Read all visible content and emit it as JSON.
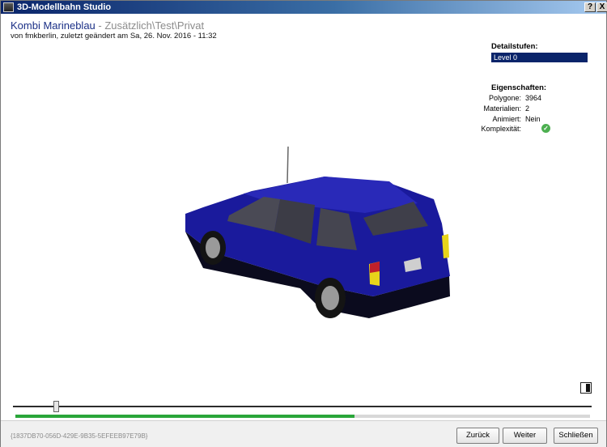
{
  "window": {
    "title": "3D-Modellbahn Studio",
    "help_label": "?",
    "close_label": "X"
  },
  "header": {
    "model_name": "Kombi Marineblau",
    "path": " - Zusätzlich\\Test\\Privat",
    "subtitle": "von fmkberlin, zuletzt geändert am Sa, 26. Nov. 2016 - 11:32"
  },
  "details": {
    "label": "Detailstufen:",
    "selected_level": "Level 0"
  },
  "properties": {
    "label": "Eigenschaften:",
    "rows": [
      {
        "key": "Polygone:",
        "value": "3964"
      },
      {
        "key": "Materialien:",
        "value": "2"
      },
      {
        "key": "Animiert:",
        "value": "Nein"
      },
      {
        "key": "Komplexität:",
        "value": ""
      }
    ],
    "complexity_icon": "check-circle-icon"
  },
  "viewport": {
    "model_icon": "car-3d-model",
    "body_color": "#1a1a9c"
  },
  "controls": {
    "slider_fraction": 0.07,
    "progress_fraction": 0.59,
    "progress_color": "#2aa63a"
  },
  "footer": {
    "guid": "{1837DB70-056D-429E-9B35-5EFEEB97E79B}",
    "back_label": "Zurück",
    "next_label": "Weiter",
    "close_label": "Schließen"
  }
}
